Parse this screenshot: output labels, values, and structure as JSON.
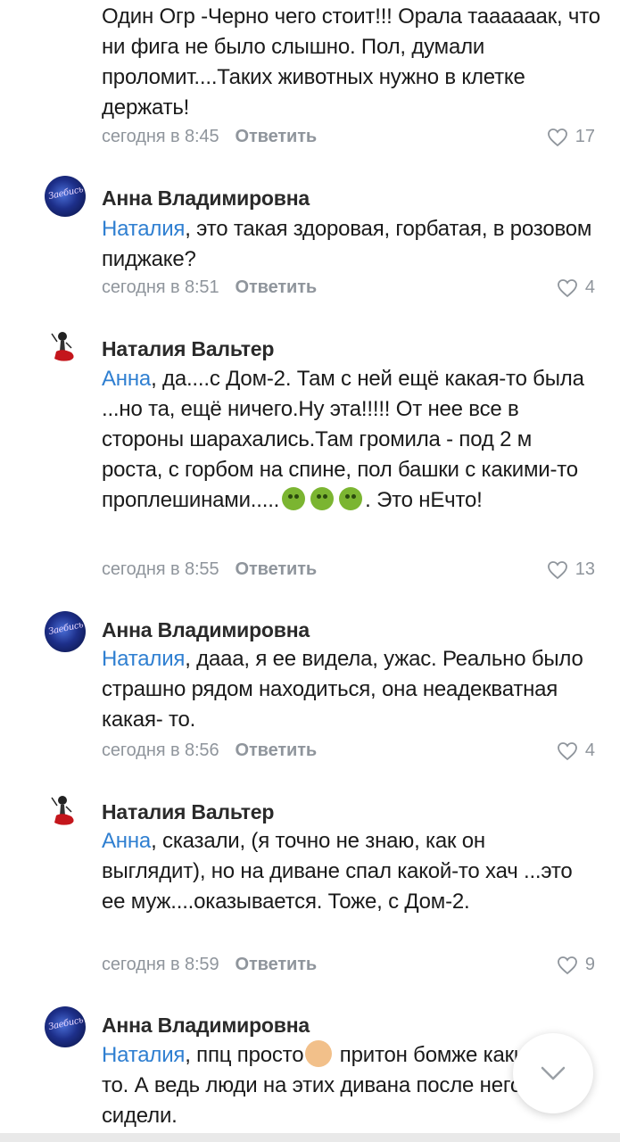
{
  "reply_label": "Ответить",
  "comments": [
    {
      "author": "",
      "mention": "",
      "text": "Один Огр -Черно чего стоит!!! Орала тааааaак, что ни фига не было слышно. Пол, думали проломит....Таких животных нужно в клетке держать!",
      "time": "сегодня в 8:45",
      "likes": "17"
    },
    {
      "author": "Анна Владимировна",
      "mention": "Наталия",
      "text": ", это такая здоровая, горбатая, в розовом пиджаке?",
      "time": "сегодня в 8:51",
      "likes": "4"
    },
    {
      "author": "Наталия Вальтер",
      "mention": "Анна",
      "text": ", да....с Дом-2. Там с ней ещё какая-то была ...но та, ещё ничего.Ну эта!!!!! От нее все в стороны шарахались.Там громила - под 2 м роста, с горбом на спине, пол башки с какими-то проплешинами.....",
      "text_after_emoji": ". Это нЕчто!",
      "time": "сегодня в 8:55",
      "likes": "13"
    },
    {
      "author": "Анна Владимировна",
      "mention": "Наталия",
      "text": ", дааа, я ее видела, ужас. Реально было страшно рядом находиться, она неадекватная какая- то.",
      "time": "сегодня в 8:56",
      "likes": "4"
    },
    {
      "author": "Наталия Вальтер",
      "mention": "Анна",
      "text": ", сказали, (я точно не знаю, как он выглядит), но на диване спал какой-то хач ...это ее муж....оказывается. Тоже, с Дом-2.",
      "time": "сегодня в 8:59",
      "likes": "9"
    },
    {
      "author": "Анна Владимировна",
      "mention": "Наталия",
      "text": ", ппц просто",
      "text_after_emoji": " притон бомже каких- то. А ведь люди на этих дивана после него сидели.",
      "time": "",
      "likes": ""
    }
  ],
  "avatar_labels": {
    "anna": "Заебись"
  },
  "colors": {
    "mention": "#2f7fd1",
    "meta": "#8f959c",
    "text": "#1a1a1a"
  },
  "icons": {
    "like": "heart-outline-icon",
    "scroll": "chevron-down-icon",
    "nauseated": "nauseated-face-emoji"
  }
}
